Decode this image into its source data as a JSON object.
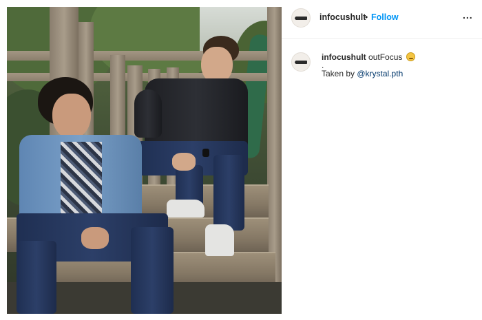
{
  "post": {
    "account": {
      "username": "infocushult",
      "separator": "•",
      "follow_label": "Follow",
      "more_label": "..."
    },
    "caption": {
      "username": "infocushult",
      "text": "outFocus",
      "emoji": "smiling-face-emoji",
      "dot_line": ".",
      "taken_by_prefix": "Taken by ",
      "mention": "@krystal.pth"
    }
  },
  "colors": {
    "follow_blue": "#0095f6",
    "mention_blue": "#00376b",
    "text": "#262626",
    "divider": "#efefef"
  }
}
